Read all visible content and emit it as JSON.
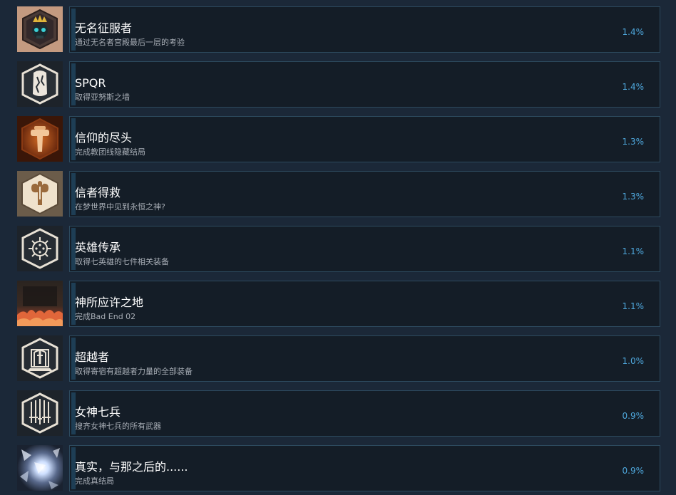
{
  "achievements": [
    {
      "name": "无名征服者",
      "desc": "通过无名者宫殿最后一层的考验",
      "pct": "1.4%",
      "icon": "crowned-skull-icon"
    },
    {
      "name": "SPQR",
      "desc": "取得亚努斯之墙",
      "pct": "1.4%",
      "icon": "cracked-wall-icon"
    },
    {
      "name": "信仰的尽头",
      "desc": "完成教团线隐藏结局",
      "pct": "1.3%",
      "icon": "cross-icon"
    },
    {
      "name": "信者得救",
      "desc": "在梦世界中见到永恒之神?",
      "pct": "1.3%",
      "icon": "cross-badge-icon"
    },
    {
      "name": "英雄传承",
      "desc": "取得七英雄的七件相关装备",
      "pct": "1.1%",
      "icon": "sun-emblem-icon"
    },
    {
      "name": "神所应许之地",
      "desc": "完成Bad End 02",
      "pct": "1.1%",
      "icon": "burning-land-icon"
    },
    {
      "name": "超越者",
      "desc": "取得寄宿有超越者力量的全部装备",
      "pct": "1.0%",
      "icon": "sword-shrine-icon"
    },
    {
      "name": "女神七兵",
      "desc": "搜齐女神七兵的所有武器",
      "pct": "0.9%",
      "icon": "weapons-icon"
    },
    {
      "name": "真实，与那之后的......",
      "desc": "完成真结局",
      "pct": "0.9%",
      "icon": "light-burst-icon"
    }
  ]
}
